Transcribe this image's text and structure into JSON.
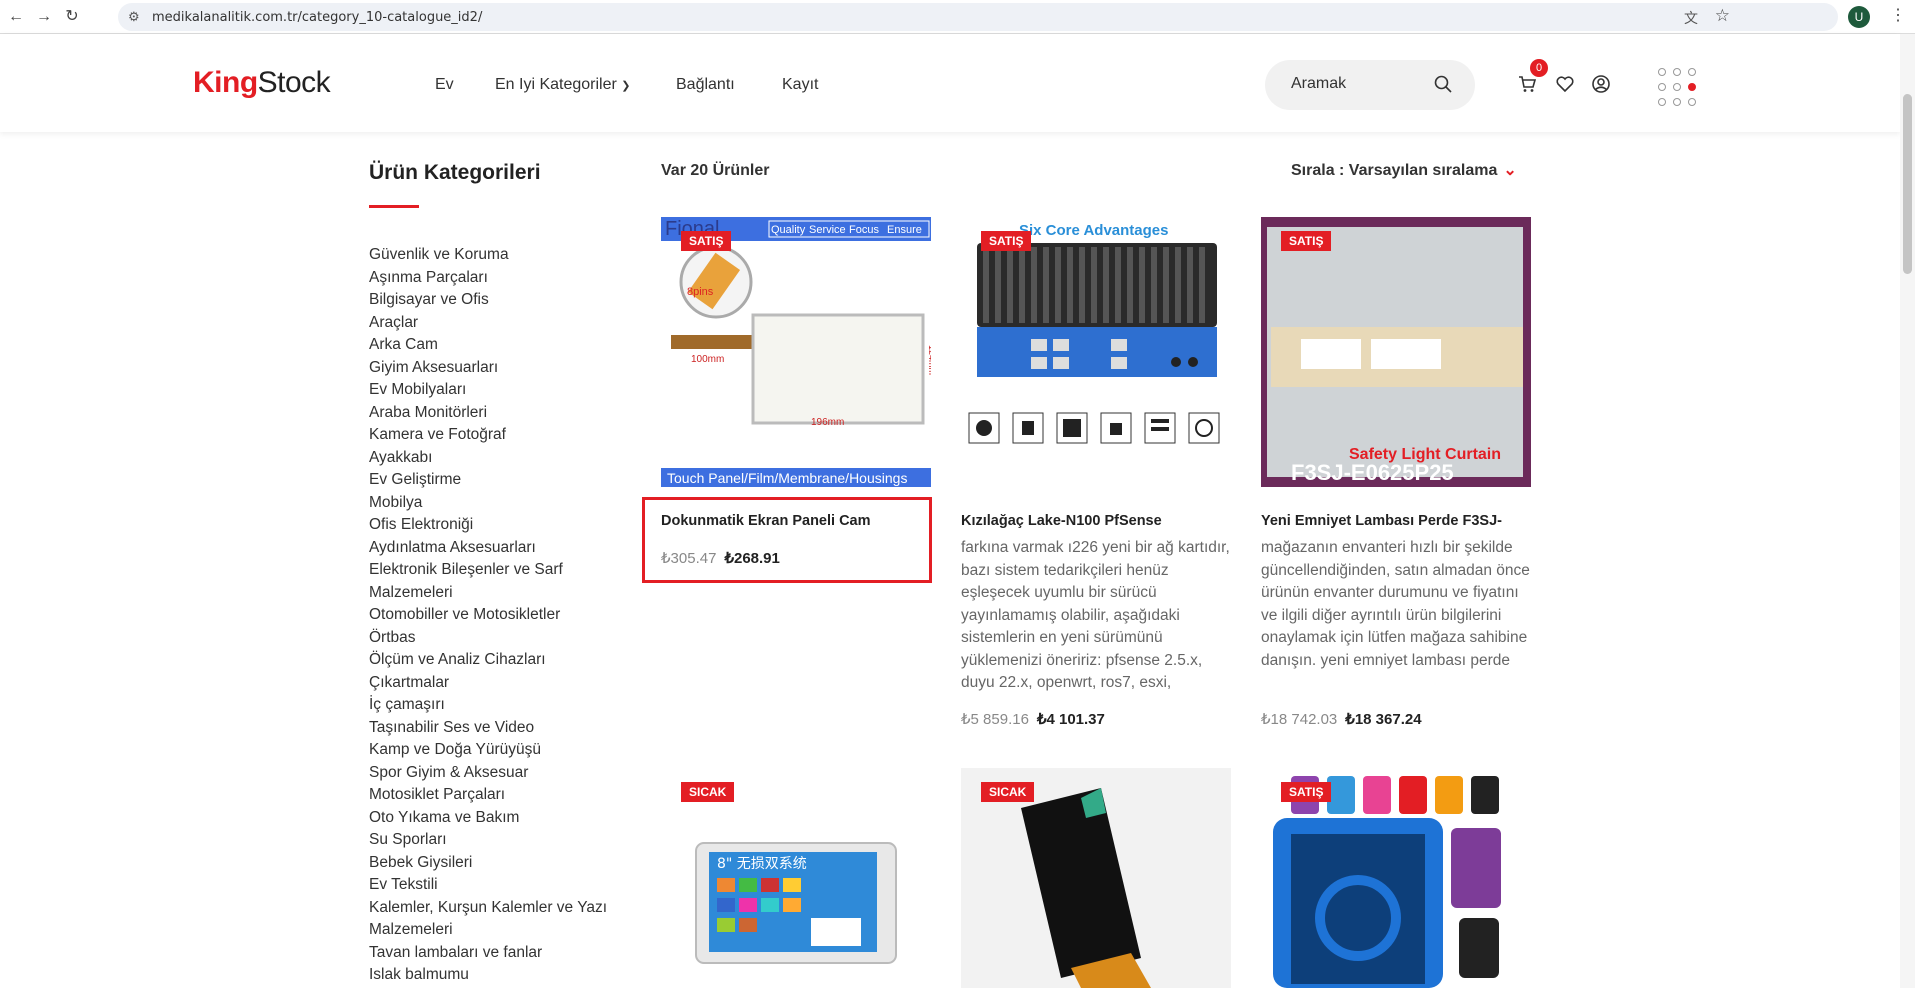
{
  "browser": {
    "url": "medikalanalitik.com.tr/category_10-catalogue_id2/",
    "profile_initial": "U"
  },
  "header": {
    "logo_part1": "King",
    "logo_part2": "Stock",
    "nav": [
      {
        "label": "Ev"
      },
      {
        "label": "En Iyi Kategoriler"
      },
      {
        "label": "Bağlantı"
      },
      {
        "label": "Kayıt"
      }
    ],
    "search_placeholder": "Aramak",
    "cart_count": "0"
  },
  "sidebar": {
    "title": "Ürün Kategorileri",
    "categories": [
      "Güvenlik ve Koruma",
      "Aşınma Parçaları",
      "Bilgisayar ve Ofis",
      "Araçlar",
      "Arka Cam",
      "Giyim Aksesuarları",
      "Ev Mobilyaları",
      "Araba Monitörleri",
      "Kamera ve Fotoğraf",
      "Ayakkabı",
      "Ev Geliştirme",
      "Mobilya",
      "Ofis Elektroniği",
      "Aydınlatma Aksesuarları",
      "Elektronik Bileşenler ve Sarf Malzemeleri",
      "Otomobiller ve Motosikletler",
      "Örtbas",
      "Ölçüm ve Analiz Cihazları",
      "Çıkartmalar",
      "İç çamaşırı",
      "Taşınabilir Ses ve Video",
      "Kamp ve Doğa Yürüyüşü",
      "Spor Giyim & Aksesuar",
      "Motosiklet Parçaları",
      "Oto Yıkama ve Bakım",
      "Su Sporları",
      "Bebek Giysileri",
      "Ev Tekstili",
      "Kalemler, Kurşun Kalemler ve Yazı Malzemeleri",
      "Tavan lambaları ve fanlar",
      "Islak balmumu"
    ]
  },
  "listing": {
    "count_text": "Var 20 Ürünler",
    "sort_text": "Sırala : Varsayılan sıralama"
  },
  "products": [
    {
      "badge": "SATIŞ",
      "name": "Dokunmatik Ekran Paneli Cam",
      "desc": "",
      "price_old": "₺305.47",
      "price_new": "₺268.91",
      "img_texts": {
        "brand": "Fional",
        "tags": [
          "Quality",
          "Service",
          "Focus",
          "Ensure"
        ],
        "pins": "8pins",
        "dim_a": "100mm",
        "dim_b": "196mm",
        "dim_c": "124mm",
        "footer": "Touch Panel/Film/Membrane/Housings"
      }
    },
    {
      "badge": "SATIŞ",
      "name": "Kızılağaç Lake-N100 PfSense",
      "desc": "farkına varmak ı226 yeni bir ağ kartıdır, bazı sistem tedarikçileri henüz eşleşecek uyumlu bir sürücü yayınlamamış olabilir, aşağıdaki sistemlerin en yeni sürümünü yüklemenizi öneririz: pfsense 2.5.x, duyu 22.x, openwrt, ros7, esxi,",
      "price_old": "₺5 859.16",
      "price_new": "₺4 101.37",
      "img_texts": {
        "title": "Six Core Advantages"
      }
    },
    {
      "badge": "SATIŞ",
      "name": "Yeni Emniyet Lambası Perde F3SJ-",
      "desc": "mağazanın envanteri hızlı bir şekilde güncellendiğinden, satın almadan önce ürünün envanter durumunu ve fiyatını ve ilgili diğer ayrıntılı ürün bilgilerini onaylamak için lütfen mağaza sahibine danışın. yeni emniyet lambası perde",
      "price_old": "₺18 742.03",
      "price_new": "₺18 367.24",
      "img_texts": {
        "line1": "Safety Light Curtain",
        "line2": "F3SJ-E0625P25"
      }
    },
    {
      "badge": "SICAK",
      "img_texts": {
        "label": "8\" 无损双系统"
      }
    },
    {
      "badge": "SICAK"
    },
    {
      "badge": "SATIŞ"
    }
  ],
  "colors": {
    "accent": "#e31e24"
  }
}
